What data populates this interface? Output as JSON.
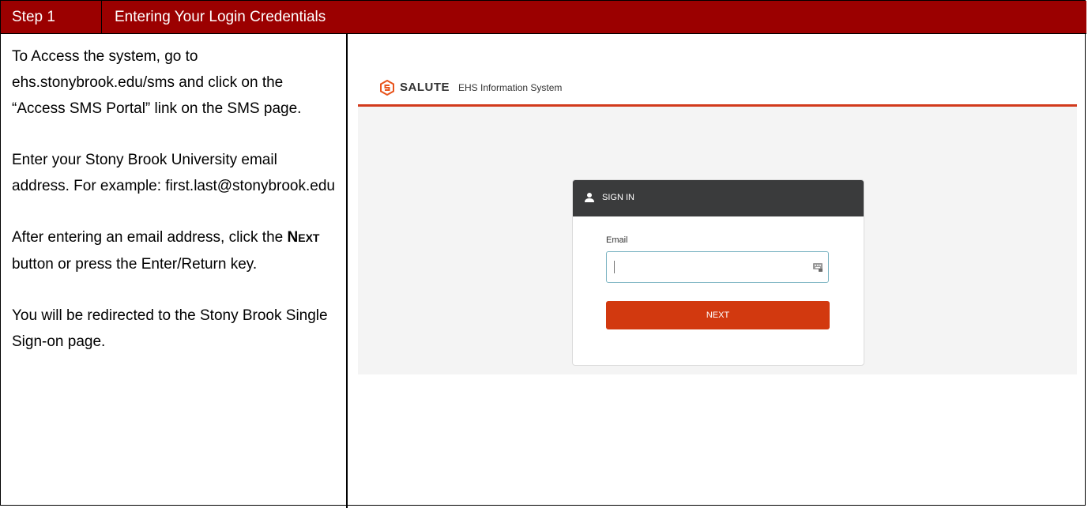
{
  "header": {
    "step": "Step 1",
    "title": "Entering Your Login Credentials"
  },
  "instructions": {
    "p1": "To Access the system, go to ehs.stonybrook.edu/sms and click on the “Access SMS Portal” link on the SMS page.",
    "p2": "Enter your Stony Brook University email address. For example: first.last@stonybrook.edu",
    "p3_pre": "After entering an email address, click the ",
    "p3_key_first": "N",
    "p3_key_rest": "EXT",
    "p3_post": " button or press the Enter/Return key.",
    "p4": "You will be redirected to the Stony Brook Single Sign-on page."
  },
  "screenshot": {
    "brand": "SALUTE",
    "subtitle": "EHS Information System",
    "signin_title": "SIGN IN",
    "email_label": "Email",
    "email_value": "",
    "next_label": "NEXT"
  },
  "colors": {
    "header_bg": "#9b0000",
    "accent": "#d2390f",
    "card_header": "#3a3b3c"
  },
  "icons": [
    "salute-logo-icon",
    "user-icon",
    "keyboard-icon"
  ]
}
